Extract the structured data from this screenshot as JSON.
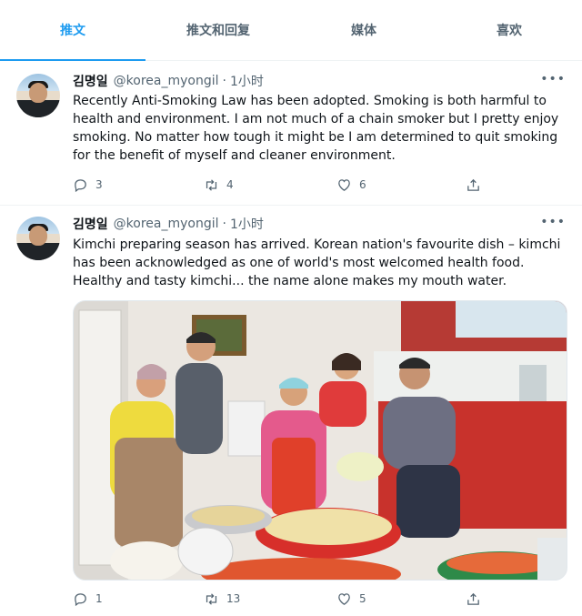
{
  "tabs": [
    {
      "label": "推文",
      "active": true
    },
    {
      "label": "推文和回复",
      "active": false
    },
    {
      "label": "媒体",
      "active": false
    },
    {
      "label": "喜欢",
      "active": false
    }
  ],
  "tweets": [
    {
      "name": "김명일",
      "handle": "@korea_myongil",
      "separator": "·",
      "time": "1小时",
      "text": "Recently Anti-Smoking Law has been adopted. Smoking is both harmful to health and environment. I am not much of a chain smoker but I pretty enjoy smoking. No matter how tough it might be I am determined to quit smoking for the benefit of myself and cleaner environment.",
      "replies": "3",
      "retweets": "4",
      "likes": "6"
    },
    {
      "name": "김명일",
      "handle": "@korea_myongil",
      "separator": "·",
      "time": "1小时",
      "text": "Kimchi preparing season has arrived. Korean nation's favourite dish – kimchi has been acknowledged as one of world's most welcomed health food. Healthy and tasty kimchi... the name alone makes my mouth water.",
      "replies": "1",
      "retweets": "13",
      "likes": "5"
    }
  ],
  "colors": {
    "accent": "#1d9bf0",
    "muted": "#536471",
    "text": "#0f1419"
  },
  "icons": [
    "more-icon",
    "reply-icon",
    "retweet-icon",
    "like-icon",
    "share-icon"
  ]
}
